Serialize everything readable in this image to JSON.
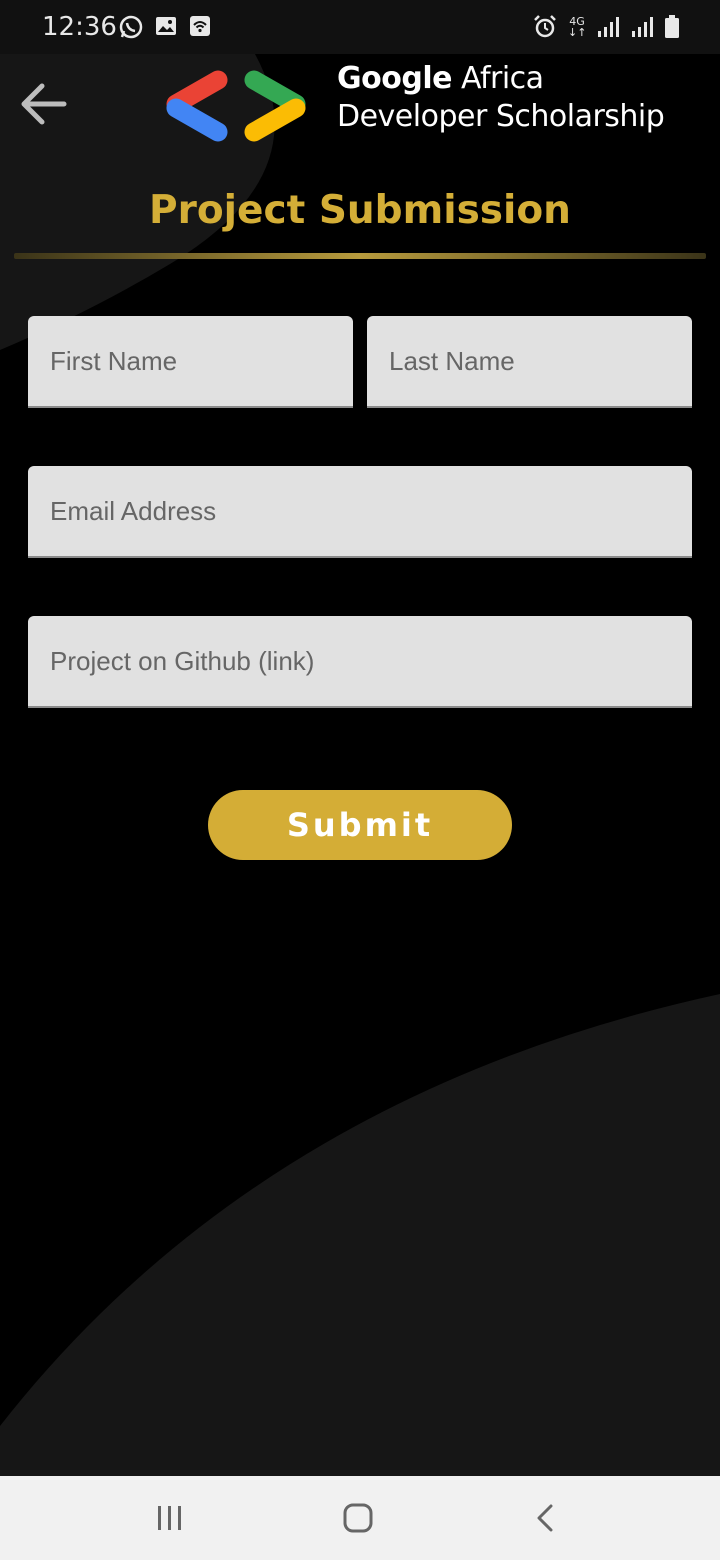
{
  "status_bar": {
    "time": "12:36",
    "network_label": "4G",
    "left_icons": [
      "whatsapp-icon",
      "image-icon",
      "wifi-calling-icon"
    ],
    "right_icons": [
      "alarm-icon",
      "network-4g-icon",
      "signal-icon",
      "signal-icon",
      "battery-icon"
    ]
  },
  "header": {
    "back_icon": "arrow-left-icon",
    "brand_bold": "Google",
    "brand_rest": " Africa",
    "brand_line2": "Developer Scholarship"
  },
  "page": {
    "title": "Project Submission"
  },
  "form": {
    "first_name_placeholder": "First Name",
    "last_name_placeholder": "Last Name",
    "email_placeholder": "Email Address",
    "github_placeholder": "Project on Github (link)",
    "submit_label": "Submit"
  },
  "nav_bar": {
    "icons": [
      "recent-apps-icon",
      "home-icon",
      "back-icon"
    ]
  },
  "colors": {
    "accent": "#d4ad36",
    "background": "#000000",
    "field": "#e1e1e1"
  }
}
